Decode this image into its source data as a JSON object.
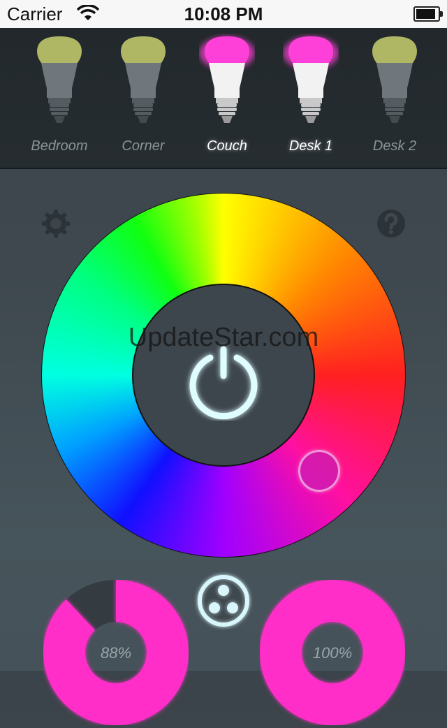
{
  "status_bar": {
    "carrier": "Carrier",
    "time": "10:08 PM",
    "battery_level": 0.9
  },
  "bulbs": [
    {
      "name": "Bedroom",
      "on": false,
      "cap_color": "#c8d070"
    },
    {
      "name": "Corner",
      "on": false,
      "cap_color": "#c8d070"
    },
    {
      "name": "Couch",
      "on": true,
      "cap_color": "#ff40d8"
    },
    {
      "name": "Desk 1",
      "on": true,
      "cap_color": "#ff40d8"
    },
    {
      "name": "Desk 2",
      "on": false,
      "cap_color": "#c8d070"
    }
  ],
  "watermark": "UpdateStar.com",
  "brightness": {
    "label": "88%",
    "value": 0.88,
    "color": "#ff2fc8"
  },
  "saturation": {
    "label": "100%",
    "value": 1.0,
    "color": "#ff2fc8"
  },
  "icons": {
    "settings": "gear-icon",
    "help": "help-icon",
    "power": "power-icon",
    "scenes": "scenes-icon"
  }
}
